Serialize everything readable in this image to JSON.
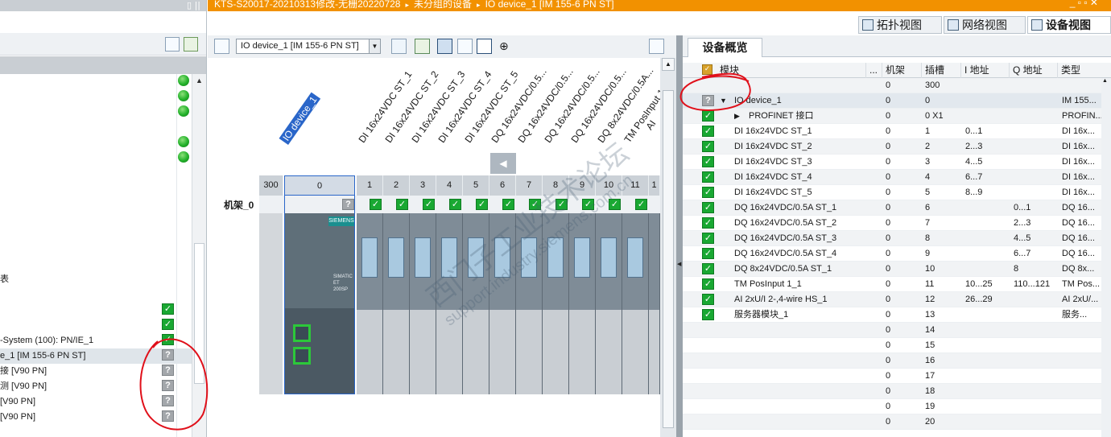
{
  "breadcrumb": {
    "items": [
      "KTS-S20017-20210313修改-无栅20220728",
      "未分组的设备",
      "IO device_1 [IM 155-6 PN ST]"
    ],
    "separator": "▸"
  },
  "view_tabs": [
    {
      "label": "拓扑视图",
      "icon": "topology-view-icon"
    },
    {
      "label": "网络视图",
      "icon": "network-view-icon"
    },
    {
      "label": "设备视图",
      "icon": "device-view-icon"
    }
  ],
  "device_toolbar": {
    "device_select": "IO device_1 [IM 155-6 PN ST]"
  },
  "left_tree": {
    "rows": [
      {
        "text": "表"
      },
      {
        "text": "-System (100): PN/IE_1"
      },
      {
        "text": "e_1 [IM 155-6 PN ST]"
      },
      {
        "text": "接 [V90 PN]"
      },
      {
        "text": "测 [V90 PN]"
      },
      {
        "text": " [V90 PN]"
      },
      {
        "text": " [V90 PN]"
      }
    ]
  },
  "canvas": {
    "rack_label": "机架_0",
    "device_label": "IO device_1",
    "slot_numbers": [
      "300",
      "0",
      "1",
      "2",
      "3",
      "4",
      "5",
      "6",
      "7",
      "8",
      "9",
      "10",
      "11",
      "1"
    ],
    "module_labels": [
      "DI 16x24VDC ST_1",
      "DI 16x24VDC ST_2",
      "DI 16x24VDC ST_3",
      "DI 16x24VDC ST_4",
      "DI 16x24VDC ST_5",
      "DQ 16x24VDC/0.5...",
      "DQ 16x24VDC/0.5...",
      "DQ 16x24VDC/0.5...",
      "DQ 16x24VDC/0.5...",
      "DQ 8x24VDC/0.5A...",
      "TM PosInput 1_1",
      "AI"
    ],
    "head_module_text": [
      "SIEMENS",
      "SIMATIC",
      "ET 200SP"
    ]
  },
  "overview": {
    "title": "设备概览",
    "columns": [
      "模块",
      "...",
      "机架",
      "插槽",
      "I 地址",
      "Q 地址",
      "类型"
    ],
    "rows": [
      {
        "status": "none",
        "module": "",
        "rack": "0",
        "slot": "300",
        "i": "",
        "q": "",
        "type": ""
      },
      {
        "status": "question",
        "expand": "▼",
        "module": "IO device_1",
        "rack": "0",
        "slot": "0",
        "i": "",
        "q": "",
        "type": "IM 155..."
      },
      {
        "status": "ok",
        "expand": "▶",
        "module": "PROFINET 接口",
        "rack": "0",
        "slot": "0 X1",
        "i": "",
        "q": "",
        "type": "PROFIN..."
      },
      {
        "status": "ok",
        "module": "DI 16x24VDC ST_1",
        "rack": "0",
        "slot": "1",
        "i": "0...1",
        "q": "",
        "type": "DI 16x..."
      },
      {
        "status": "ok",
        "module": "DI 16x24VDC ST_2",
        "rack": "0",
        "slot": "2",
        "i": "2...3",
        "q": "",
        "type": "DI 16x..."
      },
      {
        "status": "ok",
        "module": "DI 16x24VDC ST_3",
        "rack": "0",
        "slot": "3",
        "i": "4...5",
        "q": "",
        "type": "DI 16x..."
      },
      {
        "status": "ok",
        "module": "DI 16x24VDC ST_4",
        "rack": "0",
        "slot": "4",
        "i": "6...7",
        "q": "",
        "type": "DI 16x..."
      },
      {
        "status": "ok",
        "module": "DI 16x24VDC ST_5",
        "rack": "0",
        "slot": "5",
        "i": "8...9",
        "q": "",
        "type": "DI 16x..."
      },
      {
        "status": "ok",
        "module": "DQ 16x24VDC/0.5A ST_1",
        "rack": "0",
        "slot": "6",
        "i": "",
        "q": "0...1",
        "type": "DQ 16..."
      },
      {
        "status": "ok",
        "module": "DQ 16x24VDC/0.5A ST_2",
        "rack": "0",
        "slot": "7",
        "i": "",
        "q": "2...3",
        "type": "DQ 16..."
      },
      {
        "status": "ok",
        "module": "DQ 16x24VDC/0.5A ST_3",
        "rack": "0",
        "slot": "8",
        "i": "",
        "q": "4...5",
        "type": "DQ 16..."
      },
      {
        "status": "ok",
        "module": "DQ 16x24VDC/0.5A ST_4",
        "rack": "0",
        "slot": "9",
        "i": "",
        "q": "6...7",
        "type": "DQ 16..."
      },
      {
        "status": "ok",
        "module": "DQ 8x24VDC/0.5A ST_1",
        "rack": "0",
        "slot": "10",
        "i": "",
        "q": "8",
        "type": "DQ 8x..."
      },
      {
        "status": "ok",
        "module": "TM PosInput 1_1",
        "rack": "0",
        "slot": "11",
        "i": "10...25",
        "q": "110...121",
        "type": "TM Pos..."
      },
      {
        "status": "ok",
        "module": "AI 2xU/I 2-,4-wire HS_1",
        "rack": "0",
        "slot": "12",
        "i": "26...29",
        "q": "",
        "type": "AI 2xU/..."
      },
      {
        "status": "ok",
        "module": "服务器模块_1",
        "rack": "0",
        "slot": "13",
        "i": "",
        "q": "",
        "type": "服务..."
      },
      {
        "status": "none",
        "module": "",
        "rack": "0",
        "slot": "14",
        "i": "",
        "q": "",
        "type": ""
      },
      {
        "status": "none",
        "module": "",
        "rack": "0",
        "slot": "15",
        "i": "",
        "q": "",
        "type": ""
      },
      {
        "status": "none",
        "module": "",
        "rack": "0",
        "slot": "16",
        "i": "",
        "q": "",
        "type": ""
      },
      {
        "status": "none",
        "module": "",
        "rack": "0",
        "slot": "17",
        "i": "",
        "q": "",
        "type": ""
      },
      {
        "status": "none",
        "module": "",
        "rack": "0",
        "slot": "18",
        "i": "",
        "q": "",
        "type": ""
      },
      {
        "status": "none",
        "module": "",
        "rack": "0",
        "slot": "19",
        "i": "",
        "q": "",
        "type": ""
      },
      {
        "status": "none",
        "module": "",
        "rack": "0",
        "slot": "20",
        "i": "",
        "q": "",
        "type": ""
      }
    ]
  },
  "watermark": [
    "西门子工业技术论坛",
    "support.industry.siemens.com.cn"
  ],
  "colors": {
    "orange_header": "#f29100",
    "ok_green": "#19a832",
    "selection_blue": "#2a66c9",
    "annotation_red": "#e0101a"
  }
}
